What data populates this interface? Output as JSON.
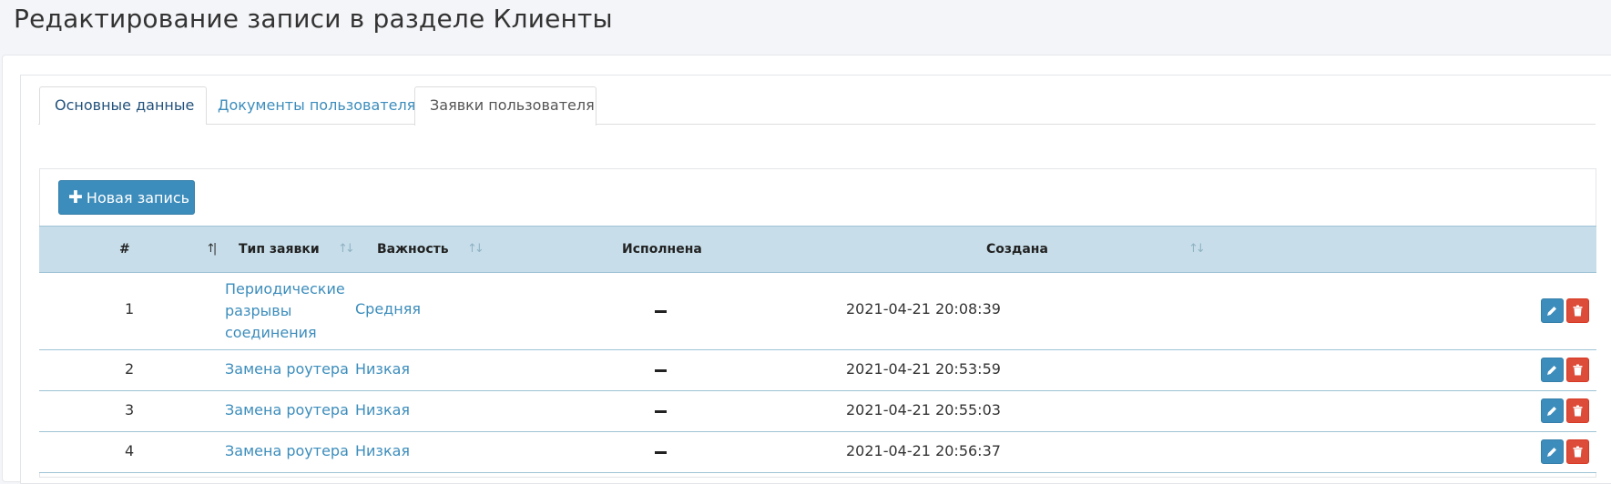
{
  "page": {
    "title": "Редактирование записи в разделе Клиенты"
  },
  "tabs": [
    {
      "label": "Основные данные"
    },
    {
      "label": "Документы пользователя"
    },
    {
      "label": "Заявки пользователя"
    }
  ],
  "toolbar": {
    "new_record_label": "Новая запись"
  },
  "table": {
    "columns": [
      "#",
      "Тип заявки",
      "Важность",
      "Исполнена",
      "Создана"
    ],
    "sorted_column": "#",
    "rows": [
      {
        "id": "1",
        "type": "Периодические разрывы соединения",
        "importance": "Средняя",
        "done": "—",
        "created": "2021-04-21 20:08:39"
      },
      {
        "id": "2",
        "type": "Замена роутера",
        "importance": "Низкая",
        "done": "—",
        "created": "2021-04-21 20:53:59"
      },
      {
        "id": "3",
        "type": "Замена роутера",
        "importance": "Низкая",
        "done": "—",
        "created": "2021-04-21 20:55:03"
      },
      {
        "id": "4",
        "type": "Замена роутера",
        "importance": "Низкая",
        "done": "—",
        "created": "2021-04-21 20:56:37"
      }
    ]
  },
  "icons": {
    "plus": "plus-icon",
    "edit": "pencil-icon",
    "delete": "trash-icon",
    "sort": "sort-icon",
    "sort_active": "sort-asc-icon"
  },
  "colors": {
    "primary": "#3c8dbc",
    "danger": "#dd4b39",
    "header_bg": "#c7deea"
  }
}
